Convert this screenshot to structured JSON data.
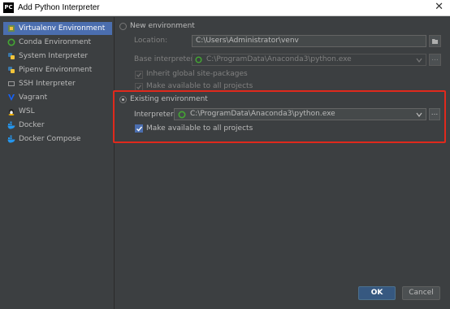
{
  "window": {
    "title": "Add Python Interpreter",
    "app_icon": "PC",
    "close_glyph": "✕"
  },
  "sidebar": {
    "items": [
      {
        "label": "Virtualenv Environment",
        "icon": "virtualenv-icon",
        "selected": true
      },
      {
        "label": "Conda Environment",
        "icon": "conda-icon"
      },
      {
        "label": "System Interpreter",
        "icon": "python-icon"
      },
      {
        "label": "Pipenv Environment",
        "icon": "pipenv-icon"
      },
      {
        "label": "SSH Interpreter",
        "icon": "ssh-icon"
      },
      {
        "label": "Vagrant",
        "icon": "vagrant-icon"
      },
      {
        "label": "WSL",
        "icon": "linux-icon"
      },
      {
        "label": "Docker",
        "icon": "docker-icon"
      },
      {
        "label": "Docker Compose",
        "icon": "docker-compose-icon"
      }
    ]
  },
  "new_env": {
    "label": "New environment",
    "location_label": "Location:",
    "location_value": "C:\\Users\\Administrator\\venv",
    "base_label": "Base interpreter:",
    "base_value": "C:\\ProgramData\\Anaconda3\\python.exe",
    "inherit_label": "Inherit global site-packages",
    "make_available_label": "Make available to all projects"
  },
  "existing_env": {
    "label": "Existing environment",
    "interpreter_label": "Interpreter:",
    "interpreter_value": "C:\\ProgramData\\Anaconda3\\python.exe",
    "ellipsis": "...",
    "make_available_label": "Make available to all projects"
  },
  "buttons": {
    "ok": "OK",
    "cancel": "Cancel"
  },
  "colors": {
    "background": "#3c3f41",
    "selection": "#4b6eaf",
    "highlight_box": "#e0291c",
    "ok_button": "#365880"
  }
}
